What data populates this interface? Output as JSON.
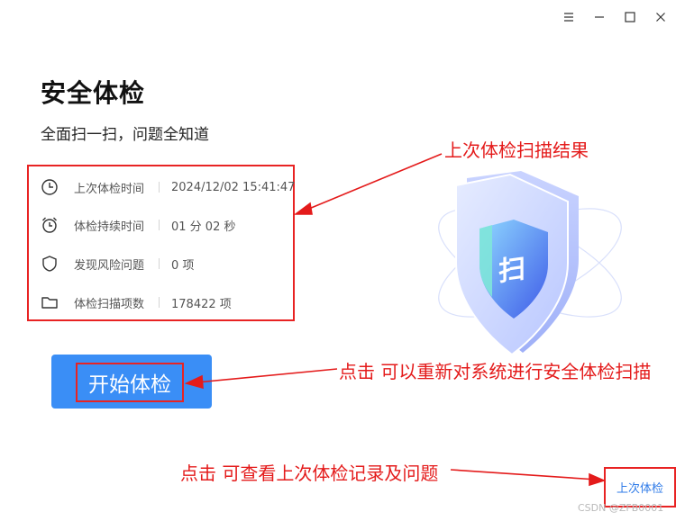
{
  "window_controls": {
    "menu_icon": "menu-icon",
    "minimize_icon": "minimize-icon",
    "maximize_icon": "maximize-icon",
    "close_icon": "close-icon"
  },
  "header": {
    "title": "安全体检",
    "subtitle": "全面扫一扫，问题全知道"
  },
  "info": {
    "rows": [
      {
        "icon": "clock-icon",
        "label": "上次体检时间",
        "value": "2024/12/02 15:41:47"
      },
      {
        "icon": "alarm-clock-icon",
        "label": "体检持续时间",
        "value": "01 分 02 秒"
      },
      {
        "icon": "shield-icon",
        "label": "发现风险问题",
        "value": "0 项"
      },
      {
        "icon": "folder-icon",
        "label": "体检扫描项数",
        "value": "178422 项"
      }
    ]
  },
  "start_button": {
    "label": "开始体检"
  },
  "illustration": {
    "badge_text": "扫"
  },
  "last_check_link": {
    "label": "上次体检"
  },
  "annotations": {
    "scan_result": "上次体检扫描结果",
    "rescan": "点击 可以重新对系统进行安全体检扫描",
    "view_last": "点击 可查看上次体检记录及问题"
  },
  "watermark": "CSDN @ZFB0001",
  "colors": {
    "accent": "#3a8ef6",
    "annotation_red": "#e41b1b",
    "link_blue": "#2f7be8"
  }
}
